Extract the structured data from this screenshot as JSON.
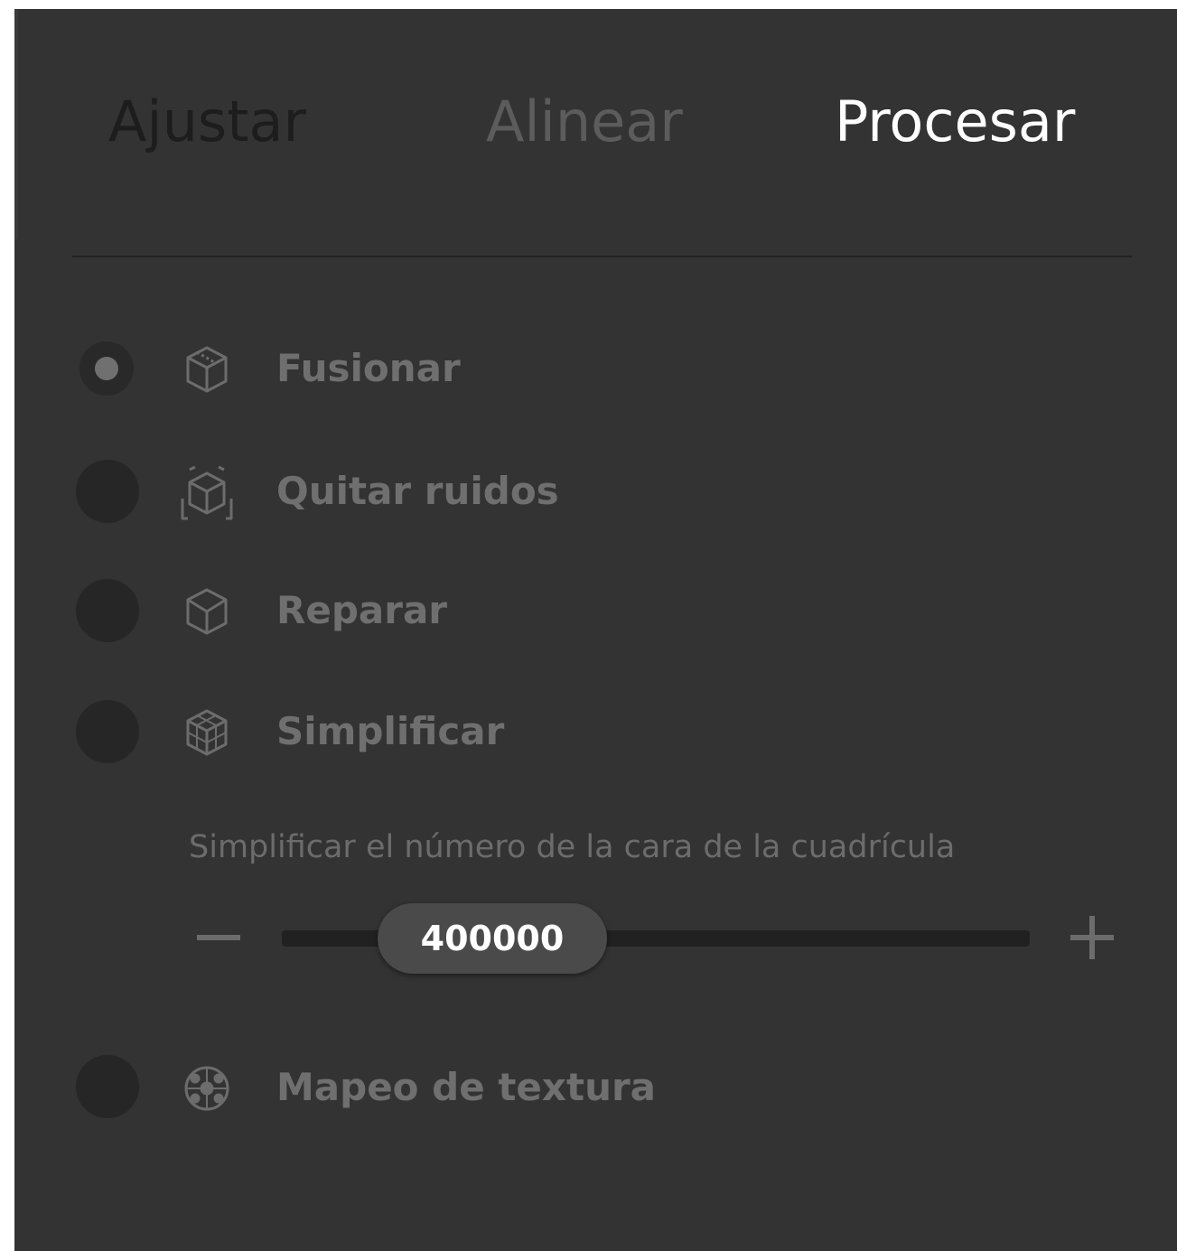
{
  "tabs": {
    "adjust": "Ajustar",
    "align": "Alinear",
    "process": "Procesar",
    "active": "Procesar"
  },
  "operations": [
    {
      "label": "Fusionar",
      "icon": "cube-icon",
      "selected": true
    },
    {
      "label": "Quitar ruidos",
      "icon": "cube-denoise-icon",
      "selected": false
    },
    {
      "label": "Reparar",
      "icon": "cube-repair-icon",
      "selected": false
    },
    {
      "label": "Simplificar",
      "icon": "cube-grid-icon",
      "selected": false
    },
    {
      "label": "Mapeo de textura",
      "icon": "texture-sphere-icon",
      "selected": false
    }
  ],
  "simplify": {
    "description": "Simplificar el número de la cara de la cuadrícula",
    "value": "400000"
  },
  "colors": {
    "panel_background": "#333333",
    "active_tab": "#ffffff",
    "inactive_tab": "#5c5c5c",
    "label": "#6f6f6f"
  }
}
